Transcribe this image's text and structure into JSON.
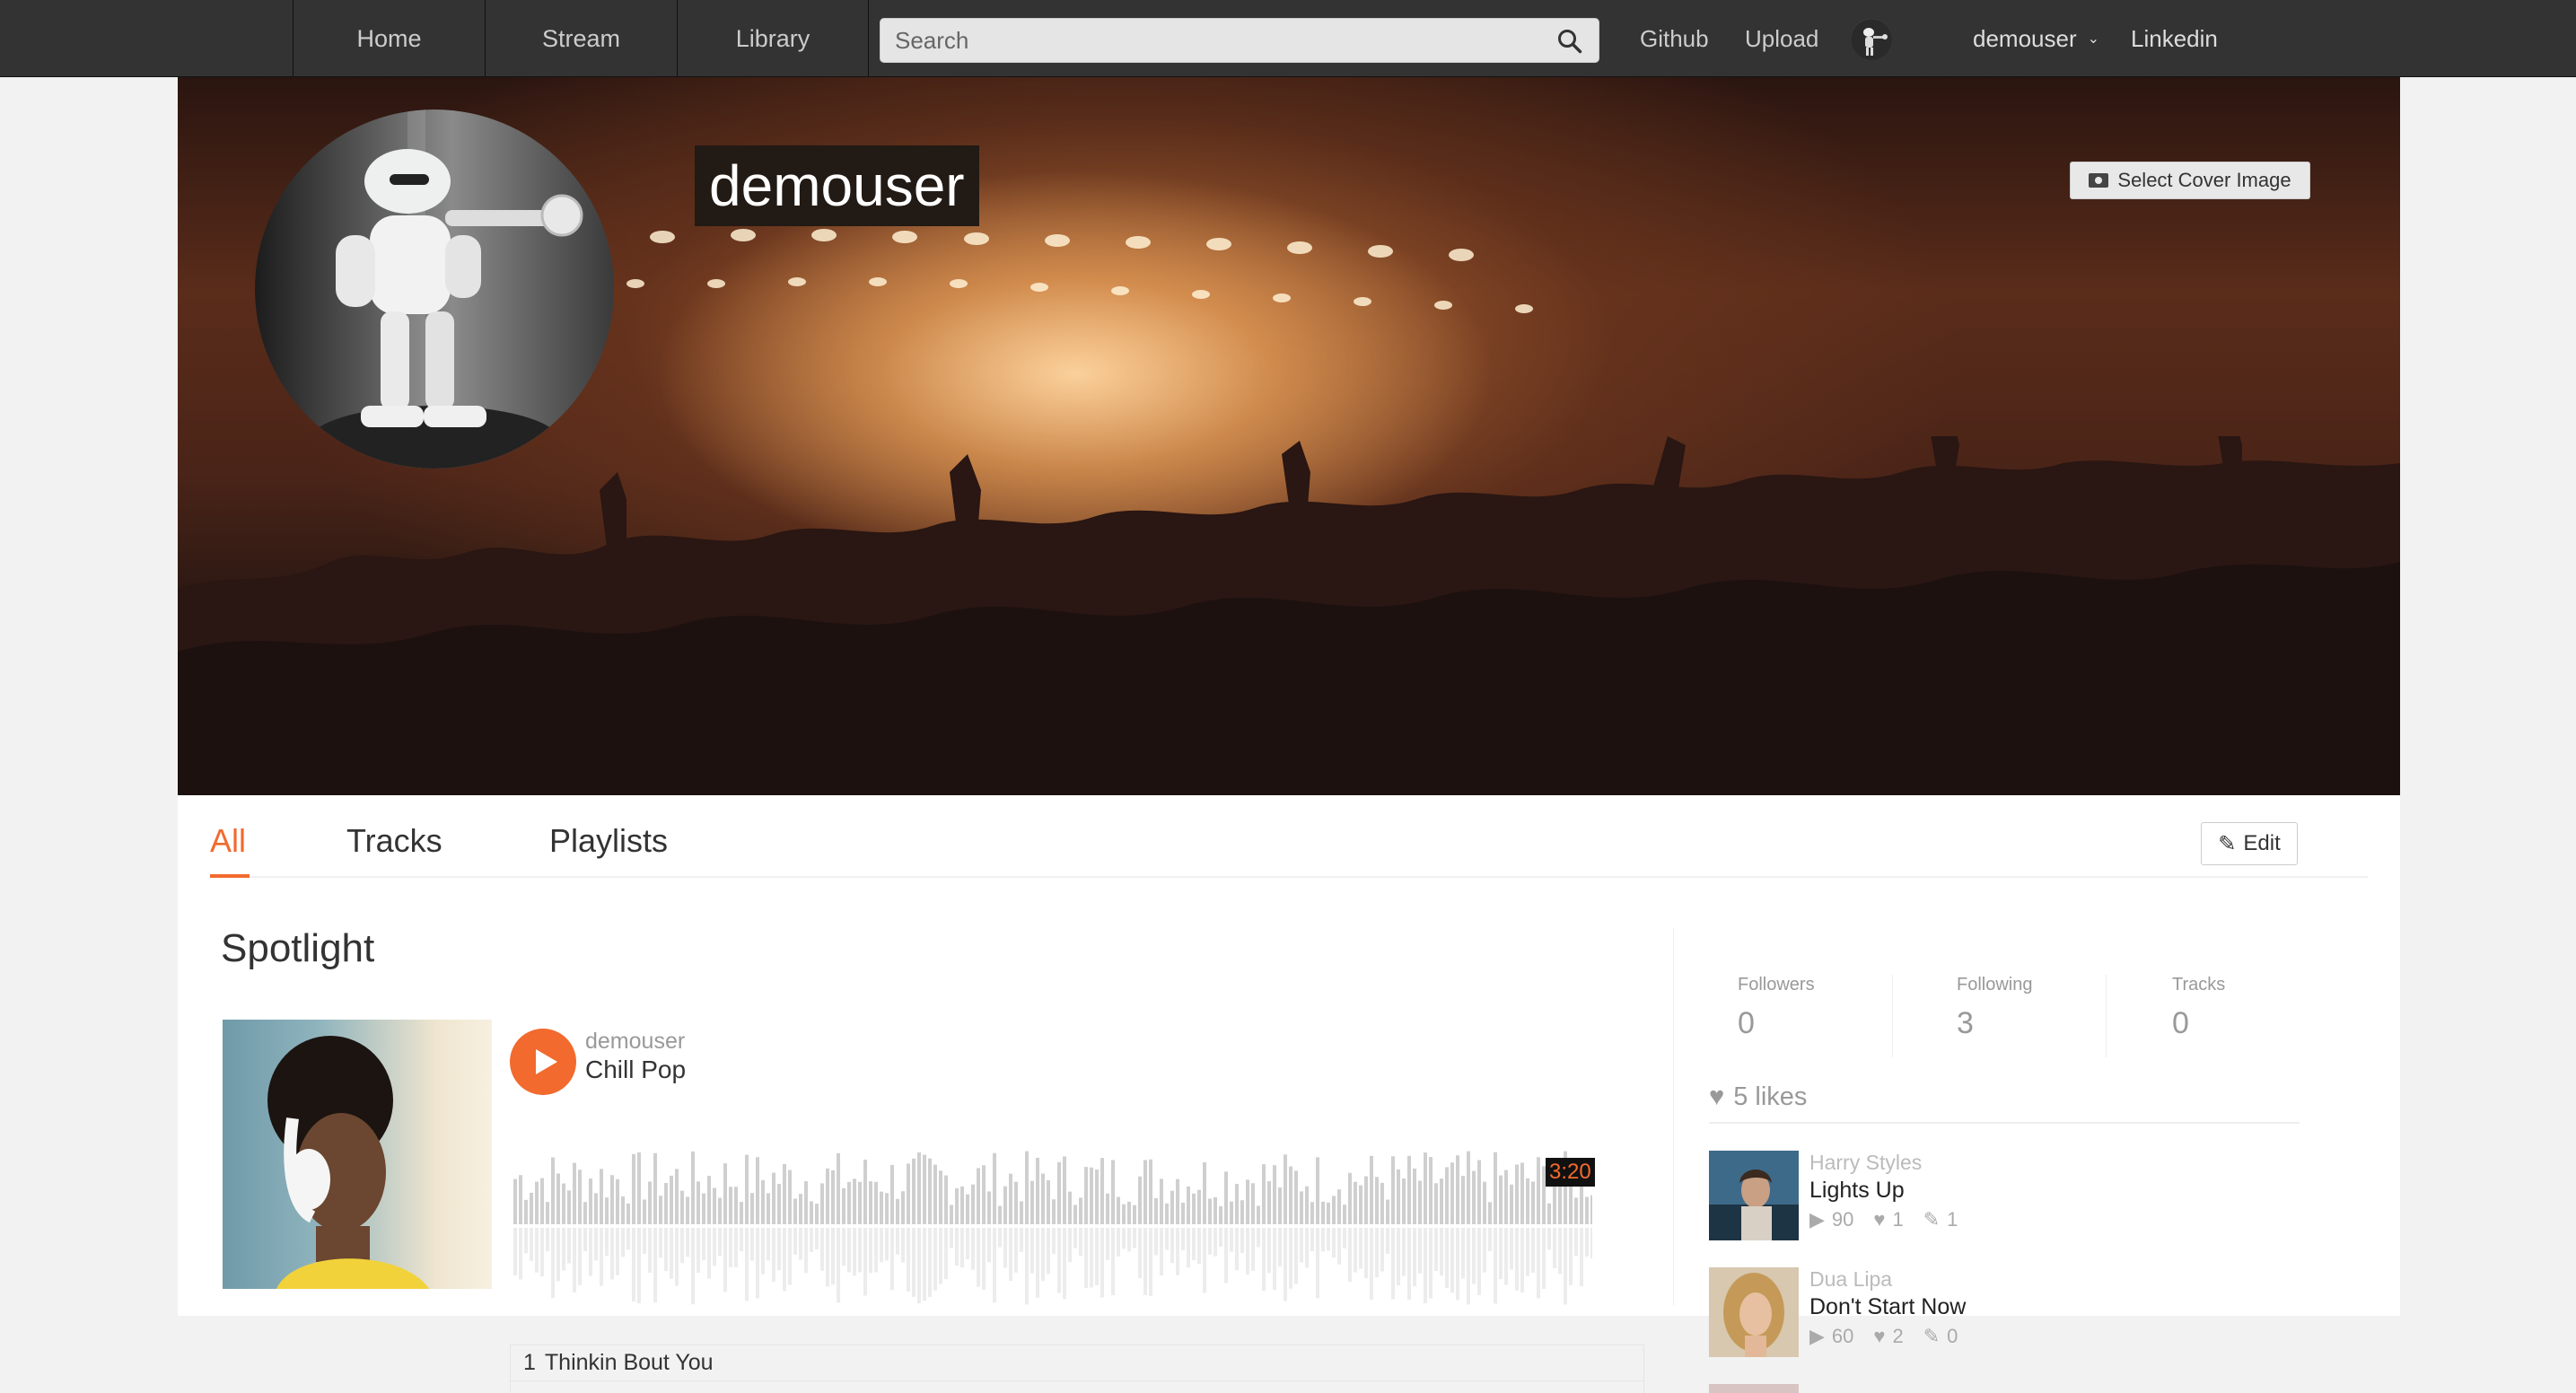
{
  "nav": {
    "tabs": [
      "Home",
      "Stream",
      "Library"
    ],
    "search_placeholder": "Search",
    "github": "Github",
    "upload": "Upload",
    "username": "demouser",
    "linkedin": "Linkedin"
  },
  "profile": {
    "name": "demouser",
    "select_cover": "Select Cover Image"
  },
  "tabs": {
    "all": "All",
    "tracks": "Tracks",
    "playlists": "Playlists",
    "edit": "Edit"
  },
  "spotlight": {
    "title": "Spotlight",
    "track_user": "demouser",
    "track_title": "Chill Pop",
    "duration": "3:20",
    "tracklist": [
      {
        "num": "1",
        "title": "Thinkin Bout You"
      }
    ]
  },
  "stats": {
    "followers_label": "Followers",
    "followers": "0",
    "following_label": "Following",
    "following": "3",
    "tracks_label": "Tracks",
    "tracks": "0"
  },
  "likes": {
    "header": "5 likes",
    "items": [
      {
        "artist": "Harry Styles",
        "title": "Lights Up",
        "plays": "90",
        "likes": "1",
        "reposts": "1"
      },
      {
        "artist": "Dua Lipa",
        "title": "Don't Start Now",
        "plays": "60",
        "likes": "2",
        "reposts": "0"
      }
    ]
  },
  "colors": {
    "accent": "#f26a2e",
    "topbar": "#333333"
  }
}
